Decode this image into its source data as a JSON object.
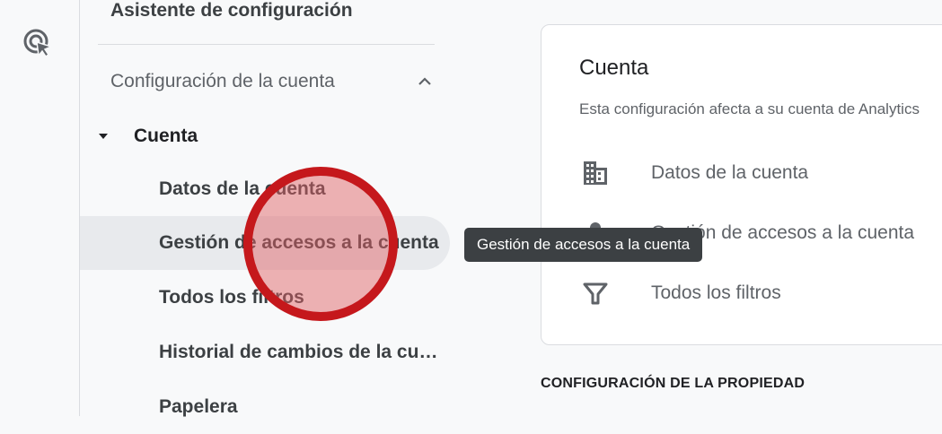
{
  "rail": {
    "icon": "analytics-admin-icon"
  },
  "sidebar": {
    "setup_assistant": "Asistente de configuración",
    "account_settings": {
      "label": "Configuración de la cuenta",
      "icon": "chevron-up-icon"
    },
    "account_group": {
      "label": "Cuenta",
      "icon": "caret-down-icon"
    },
    "items": [
      {
        "label": "Datos de la cuenta"
      },
      {
        "label": "Gestión de accesos a la cuenta",
        "active": true
      },
      {
        "label": "Todos los filtros"
      },
      {
        "label": "Historial de cambios de la cuenta"
      },
      {
        "label": "Papelera"
      }
    ]
  },
  "card": {
    "title": "Cuenta",
    "subtitle": "Esta configuración afecta a su cuenta de Analytics",
    "rows": [
      {
        "label": "Datos de la cuenta",
        "icon": "building-icon"
      },
      {
        "label": "Gestión de accesos a la cuenta",
        "icon": "person-icon"
      },
      {
        "label": "Todos los filtros",
        "icon": "filter-icon"
      }
    ]
  },
  "property_section": {
    "title": "CONFIGURACIÓN DE LA PROPIEDAD"
  },
  "tooltip": {
    "text": "Gestión de accesos a la cuenta"
  },
  "colors": {
    "active_bg": "#e8eaed",
    "tooltip_bg": "#3c4043",
    "click_marker": "#c5181c"
  }
}
